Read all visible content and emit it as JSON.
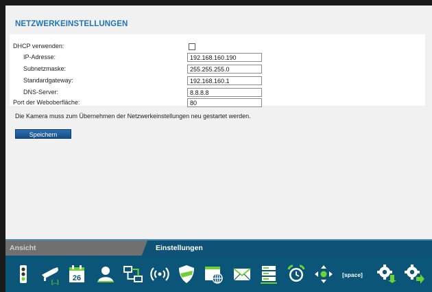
{
  "settings": {
    "title": "NETZWERKEINSTELLUNGEN",
    "rows": [
      {
        "label": "DHCP verwenden:",
        "type": "checkbox",
        "checked": false
      },
      {
        "label": "IP-Adresse:",
        "type": "text",
        "value": "192.168.160.190"
      },
      {
        "label": "Subnetzmaske:",
        "type": "text",
        "value": "255.255.255.0"
      },
      {
        "label": "Standardgateway:",
        "type": "text",
        "value": "192.168.160.1"
      },
      {
        "label": "DNS-Server:",
        "type": "text",
        "value": "8.8.8.8"
      },
      {
        "label": "Port der Weboberfläche:",
        "type": "text",
        "value": "80"
      }
    ],
    "note": "Die Kamera muss zum Übernehmen der Netzwerkeinstellungen neu gestartet werden.",
    "save_label": "Speichern"
  },
  "tabs": [
    {
      "label": "Ansicht",
      "active": false
    },
    {
      "label": "Einstellungen",
      "active": true
    }
  ],
  "toolbar": {
    "calendar_day": "26",
    "space_label": "[space]",
    "icons": [
      "traffic-light-icon",
      "camera-icon",
      "calendar-icon",
      "user-icon",
      "network-icon",
      "wireless-icon",
      "shield-icon",
      "web-icon",
      "mail-icon",
      "server-icon",
      "alarm-clock-icon",
      "ptz-control-icon",
      "space-icon",
      "gear-down-icon",
      "gear-right-icon"
    ]
  },
  "colors": {
    "title": "#1e74b7",
    "toolbar_bg": "#0b5678",
    "icon_white": "#ffffff",
    "icon_green": "#6ed235"
  }
}
